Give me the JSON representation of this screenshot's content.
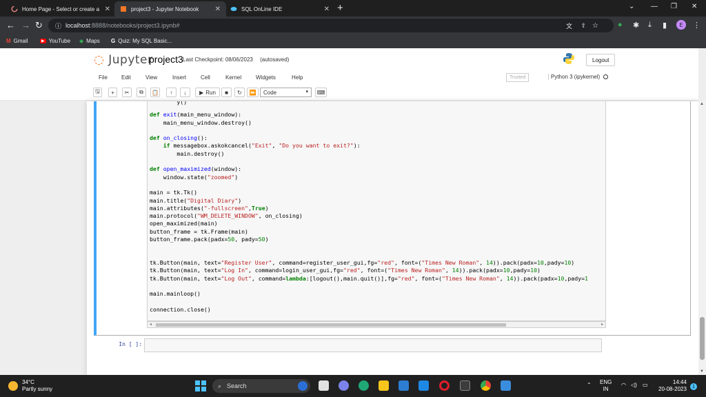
{
  "browser": {
    "tabs": [
      {
        "title": "Home Page - Select or create a n",
        "icon": "loading-icon"
      },
      {
        "title": "project3 - Jupyter Notebook",
        "icon": "jupyter-icon"
      },
      {
        "title": "SQL OnLine IDE",
        "icon": "sql-icon"
      }
    ],
    "url_host": "localhost",
    "url_path": ":8888/notebooks/project3.ipynb#",
    "profile_initial": "E",
    "bookmarks": [
      {
        "label": "Gmail",
        "icon": "M"
      },
      {
        "label": "YouTube",
        "icon": "▶"
      },
      {
        "label": "Maps",
        "icon": "◆"
      },
      {
        "label": "Quiz: My SQL Basic...",
        "icon": "G"
      }
    ]
  },
  "jupyter": {
    "logo_text": "Jupyter",
    "notebook_name": "project3",
    "checkpoint": "Last Checkpoint: 08/06/2023",
    "autosave": "(autosaved)",
    "logout": "Logout",
    "menu": [
      "File",
      "Edit",
      "View",
      "Insert",
      "Cell",
      "Kernel",
      "Widgets",
      "Help"
    ],
    "trusted": "Trusted",
    "kernel": "Python 3 (ipykernel)",
    "toolbar": {
      "run": "Run",
      "cell_type": "Code"
    },
    "empty_prompt": "In [ ]:"
  },
  "taskbar": {
    "temp": "34°C",
    "weather": "Partly sunny",
    "search": "Search",
    "lang1": "ENG",
    "lang2": "IN",
    "time": "14:44",
    "date": "20-08-2023",
    "notif_count": "1"
  }
}
